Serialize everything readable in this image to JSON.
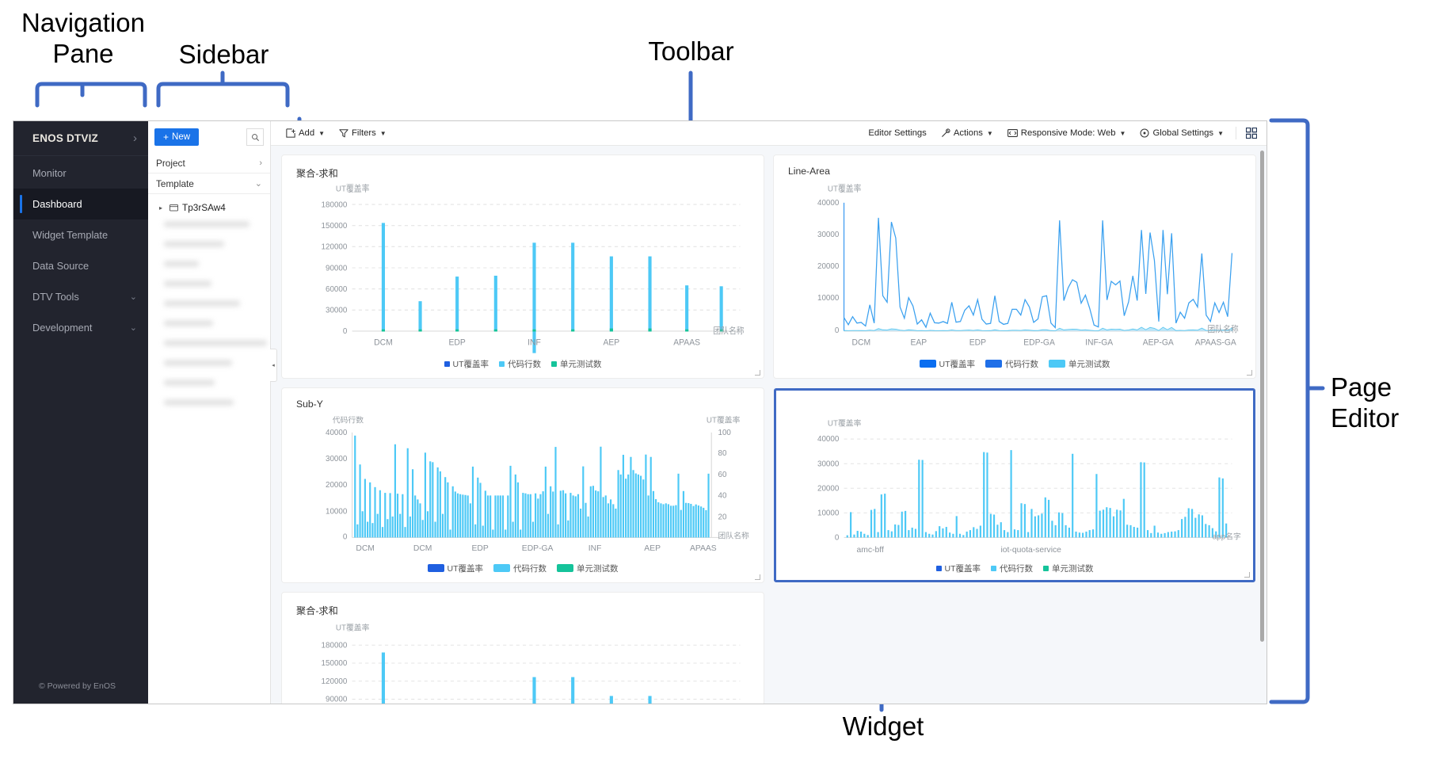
{
  "annotations": [
    {
      "id": "navigation-pane",
      "label": "Navigation\nPane"
    },
    {
      "id": "sidebar",
      "label": "Sidebar"
    },
    {
      "id": "toolbar",
      "label": "Toolbar"
    },
    {
      "id": "page-editor",
      "label": "Page\nEditor"
    },
    {
      "id": "widget",
      "label": "Widget"
    }
  ],
  "nav": {
    "brand": "ENOS DTVIZ",
    "brand_chevron": "›",
    "items": [
      {
        "label": "Monitor",
        "active": false,
        "expandable": false
      },
      {
        "label": "Dashboard",
        "active": true,
        "expandable": false
      },
      {
        "label": "Widget Template",
        "active": false,
        "expandable": false
      },
      {
        "label": "Data Source",
        "active": false,
        "expandable": false
      },
      {
        "label": "DTV Tools",
        "active": false,
        "expandable": true
      },
      {
        "label": "Development",
        "active": false,
        "expandable": true
      }
    ],
    "footer": "© Powered by EnOS"
  },
  "sidebar": {
    "new_button": "New",
    "new_plus": "+",
    "search_icon": "search-icon",
    "rows": [
      {
        "label": "Project",
        "chevron": "›"
      },
      {
        "label": "Template",
        "chevron": "⌄"
      }
    ],
    "tree": [
      {
        "label": "Tp3rSAw4",
        "caret": "▸",
        "folder": "folder-icon"
      }
    ],
    "blurred_item_count": 10,
    "collapse_handle": "◂"
  },
  "toolbar": {
    "left": [
      {
        "label": "Add",
        "icon": "add-widget-icon",
        "caret": "▼"
      },
      {
        "label": "Filters",
        "icon": "filter-icon",
        "caret": "▼"
      }
    ],
    "right": [
      {
        "label": "Editor Settings",
        "icon": null,
        "caret": null
      },
      {
        "label": "Actions",
        "icon": "wand-icon",
        "caret": "▼"
      },
      {
        "label": "Responsive Mode: Web",
        "icon": "responsive-icon",
        "caret": "▼"
      },
      {
        "label": "Global Settings",
        "icon": "gear-dot-icon",
        "caret": "▼"
      }
    ],
    "fullscreen_icon": "fullscreen-icon"
  },
  "colors": {
    "accent": "#1a73e8",
    "selection": "#3f6ac4",
    "nav_bg": "#22242e",
    "canvas_bg": "#f5f7fa",
    "series_ut": "#1f5fe0",
    "series_loc": "#4dc9f6",
    "series_ut_tests": "#15c39a"
  },
  "chart_data": [
    {
      "id": "widget-aggregate-sum-top",
      "type": "bar",
      "title": "聚合-求和",
      "ylabel": "UT覆盖率",
      "xlabel": "团队名称",
      "ylim": [
        0,
        180000
      ],
      "yticks": [
        0,
        30000,
        60000,
        90000,
        120000,
        150000,
        180000
      ],
      "grid": true,
      "legend": [
        "UT覆盖率",
        "代码行数",
        "单元测试数"
      ],
      "legend_position": "bottom",
      "xticks": [
        "DCM",
        "EDP",
        "INF",
        "AEP",
        "APAAS"
      ],
      "categories": [
        "DCM",
        "",
        "EDP",
        "",
        "INF",
        "",
        "AEP",
        "",
        "APAAS",
        ""
      ],
      "values": [
        167000,
        46000,
        65000,
        65500,
        132000,
        132000,
        110000,
        110000,
        75000,
        74500
      ]
    },
    {
      "id": "widget-line-area",
      "type": "line",
      "title": "Line-Area",
      "ylabel": "UT覆盖率",
      "xlabel": "团队名称",
      "ylim": [
        0,
        40000
      ],
      "yticks": [
        0,
        10000,
        20000,
        30000,
        40000
      ],
      "grid": false,
      "legend": [
        "UT覆盖率",
        "代码行数",
        "单元测试数"
      ],
      "legend_position": "bottom",
      "xticks": [
        "DCM",
        "EAP",
        "EDP",
        "EDP-GA",
        "INF-GA",
        "AEP-GA",
        "APAAS-GA"
      ],
      "series": [
        {
          "name": "代码行数",
          "values": [
            4200,
            2000,
            4500,
            2500,
            2700,
            1600,
            8200,
            2500,
            35300,
            11000,
            9000,
            34000,
            29000,
            7500,
            4000,
            10400,
            7800,
            2200,
            3500,
            1200,
            5600,
            2600,
            2500,
            3000,
            2400,
            9000,
            2800,
            3000,
            6500,
            7900,
            5000,
            9800,
            3700,
            2200,
            2400,
            11000,
            3000,
            2100,
            2400,
            6800,
            6800,
            5000,
            9800,
            7500,
            2700,
            3800,
            10700,
            11000,
            2500,
            1100,
            34500,
            9500,
            13500,
            16000,
            15200,
            8700,
            11200,
            7000,
            1900,
            1300,
            34500,
            9700,
            15500,
            14400,
            15600,
            4800,
            9100,
            17200,
            9500,
            31500,
            11600,
            30700,
            22000,
            3000,
            31500,
            11500,
            30500,
            2500,
            5900,
            4000,
            8800,
            9900,
            7500,
            24200,
            5000,
            3000,
            8800,
            5800,
            9000,
            4500,
            24300
          ]
        },
        {
          "name": "单元测试数",
          "values": [
            200,
            150,
            200,
            180,
            160,
            140,
            300,
            200,
            800,
            400,
            350,
            700,
            600,
            300,
            200,
            400,
            300,
            150,
            200,
            120,
            250,
            160,
            150,
            180,
            150,
            350,
            180,
            180,
            280,
            320,
            220,
            380,
            200,
            150,
            160,
            420,
            180,
            140,
            160,
            280,
            280,
            220,
            380,
            300,
            170,
            200,
            410,
            420,
            160,
            110,
            900,
            380,
            520,
            600,
            580,
            340,
            430,
            280,
            130,
            100,
            900,
            380,
            600,
            560,
            600,
            220,
            360,
            660,
            380,
            1200,
            450,
            1150,
            850,
            180,
            1200,
            440,
            1150,
            160,
            240,
            180,
            350,
            390,
            300,
            920,
            220,
            180,
            350,
            240,
            360,
            200,
            930
          ]
        }
      ]
    },
    {
      "id": "widget-sub-y",
      "type": "bar",
      "title": "Sub-Y",
      "ylabel": "代码行数",
      "ylabel_right": "UT覆盖率",
      "xlabel": "团队名称",
      "ylim": [
        0,
        40000
      ],
      "yticks": [
        0,
        10000,
        20000,
        30000,
        40000
      ],
      "ylim_right": [
        0,
        100
      ],
      "yticks_right": [
        20,
        40,
        60,
        80,
        100
      ],
      "grid": false,
      "legend": [
        "UT覆盖率",
        "代码行数",
        "单元测试数"
      ],
      "legend_position": "bottom",
      "xticks": [
        "DCM",
        "DCM",
        "EDP",
        "EDP-GA",
        "INF",
        "AEP",
        "APAAS"
      ],
      "values": [
        38800,
        5000,
        27800,
        10000,
        22300,
        6000,
        21000,
        5500,
        19200,
        9000,
        18000,
        4000,
        17000,
        7000,
        16900,
        8000,
        35500,
        16700,
        9000,
        16500,
        4000,
        34000,
        8000,
        26000,
        16000,
        14500,
        13000,
        6700,
        32300,
        10000,
        29000,
        28700,
        6000,
        26700,
        25200,
        9000,
        23000,
        21000,
        3000,
        19500,
        17500,
        16800,
        16500,
        16300,
        16200,
        16000,
        13000,
        27000,
        5000,
        22800,
        20800,
        4500,
        17800,
        16000,
        16000,
        3000,
        16000,
        16000,
        16000,
        16000,
        3000,
        16000,
        27300,
        6000,
        24000,
        21000,
        3000,
        17000,
        16800,
        16500,
        16500,
        6000,
        16800,
        14800,
        16500,
        17600,
        27000,
        9000,
        19500,
        17500,
        34500,
        5000,
        17800,
        18000,
        16800,
        6500,
        17000,
        16000,
        15700,
        16500,
        11000,
        27100,
        13200,
        8000,
        19500,
        19700,
        17900,
        17600,
        34600,
        15400,
        16000,
        13000,
        14500,
        12700,
        11000,
        25700,
        24000,
        31500,
        22400,
        24000,
        30700,
        25700,
        24400,
        24000,
        23500,
        22100,
        31600,
        16000,
        30700,
        17700,
        14600,
        13400,
        13000,
        12700,
        13000,
        12700,
        12100,
        12100,
        12300,
        24300,
        10500,
        17700,
        13200,
        13100,
        12800,
        12000,
        12600,
        12200,
        11800,
        11300,
        10400,
        24300
      ]
    },
    {
      "id": "widget-app-bars",
      "type": "bar",
      "title": "",
      "ylabel": "UT覆盖率",
      "xlabel": "app名字",
      "ylim": [
        0,
        40000
      ],
      "yticks": [
        0,
        10000,
        20000,
        30000,
        40000
      ],
      "grid": true,
      "legend": [
        "UT覆盖率",
        "代码行数",
        "单元测试数"
      ],
      "legend_position": "bottom",
      "xticks": [
        "amc-bff",
        "iot-quota-service"
      ],
      "values": [
        900,
        10300,
        1200,
        2700,
        2400,
        1500,
        1000,
        11200,
        11600,
        2200,
        17500,
        17800,
        3000,
        2500,
        5300,
        5100,
        10500,
        10800,
        3000,
        4000,
        3500,
        31600,
        31500,
        2200,
        1500,
        1200,
        2600,
        4600,
        3700,
        4300,
        2000,
        1500,
        8700,
        1500,
        1000,
        2400,
        3000,
        4200,
        3500,
        4800,
        34700,
        34500,
        9600,
        9300,
        5200,
        6200,
        3000,
        2200,
        35500,
        3300,
        3000,
        13900,
        13600,
        2200,
        11600,
        8600,
        9000,
        9700,
        16300,
        15300,
        6800,
        5000,
        10200,
        9900,
        5000,
        4000,
        34000,
        2400,
        2000,
        1900,
        2400,
        3000,
        3300,
        25800,
        10900,
        11300,
        12300,
        12000,
        8600,
        11300,
        11000,
        15700,
        5200,
        5000,
        4300,
        4000,
        30600,
        30500,
        3000,
        1800,
        4800,
        2000,
        1500,
        1800,
        2200,
        2400,
        2500,
        3000,
        7500,
        8400,
        11900,
        11600,
        8000,
        9400,
        9000,
        5500,
        5000,
        3800,
        2500,
        24400,
        24000,
        5700
      ]
    },
    {
      "id": "widget-aggregate-sum-bottom",
      "type": "bar",
      "title": "聚合-求和",
      "ylabel": "UT覆盖率",
      "xlabel": "",
      "ylim": [
        0,
        180000
      ],
      "yticks": [
        90000,
        120000,
        150000,
        180000
      ],
      "grid": true,
      "legend": [],
      "legend_position": "bottom",
      "xticks": [],
      "values": [
        167000,
        0,
        0,
        0,
        132000,
        132000,
        110000,
        110000,
        0,
        0
      ]
    }
  ]
}
